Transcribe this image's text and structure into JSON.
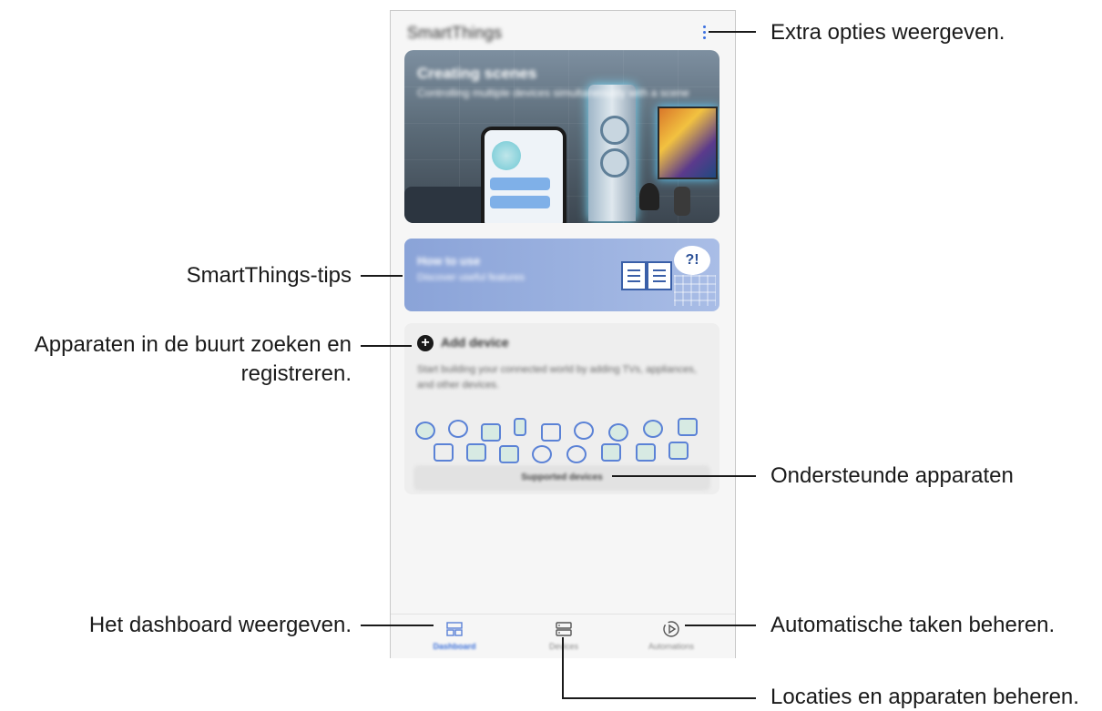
{
  "app": {
    "title": "SmartThings",
    "more_icon": "more-vertical-icon"
  },
  "hero": {
    "title": "Creating scenes",
    "subtitle": "Controlling multiple devices simultaneously with a scene"
  },
  "tips_card": {
    "title": "How to use",
    "subtitle": "Discover useful features",
    "badge": "?!"
  },
  "add_device_card": {
    "title": "Add device",
    "description": "Start building your connected world by adding TVs, appliances, and other devices.",
    "supported_label": "Supported devices"
  },
  "bottom_nav": [
    {
      "label": "Dashboard",
      "icon": "dashboard-icon",
      "active": true
    },
    {
      "label": "Devices",
      "icon": "devices-icon",
      "active": false
    },
    {
      "label": "Automations",
      "icon": "automations-icon",
      "active": false
    }
  ],
  "callouts": {
    "more_options": "Extra opties weergeven.",
    "tips": "SmartThings-tips",
    "add_device_line1": "Apparaten in de buurt zoeken en",
    "add_device_line2": "registreren.",
    "supported": "Ondersteunde apparaten",
    "dashboard": "Het dashboard weergeven.",
    "automations": "Automatische taken beheren.",
    "devices": "Locaties en apparaten beheren."
  },
  "colors": {
    "accent": "#3b6fe0",
    "card_bg": "#eeeeee",
    "tips_bg": "#8aa3d8"
  }
}
